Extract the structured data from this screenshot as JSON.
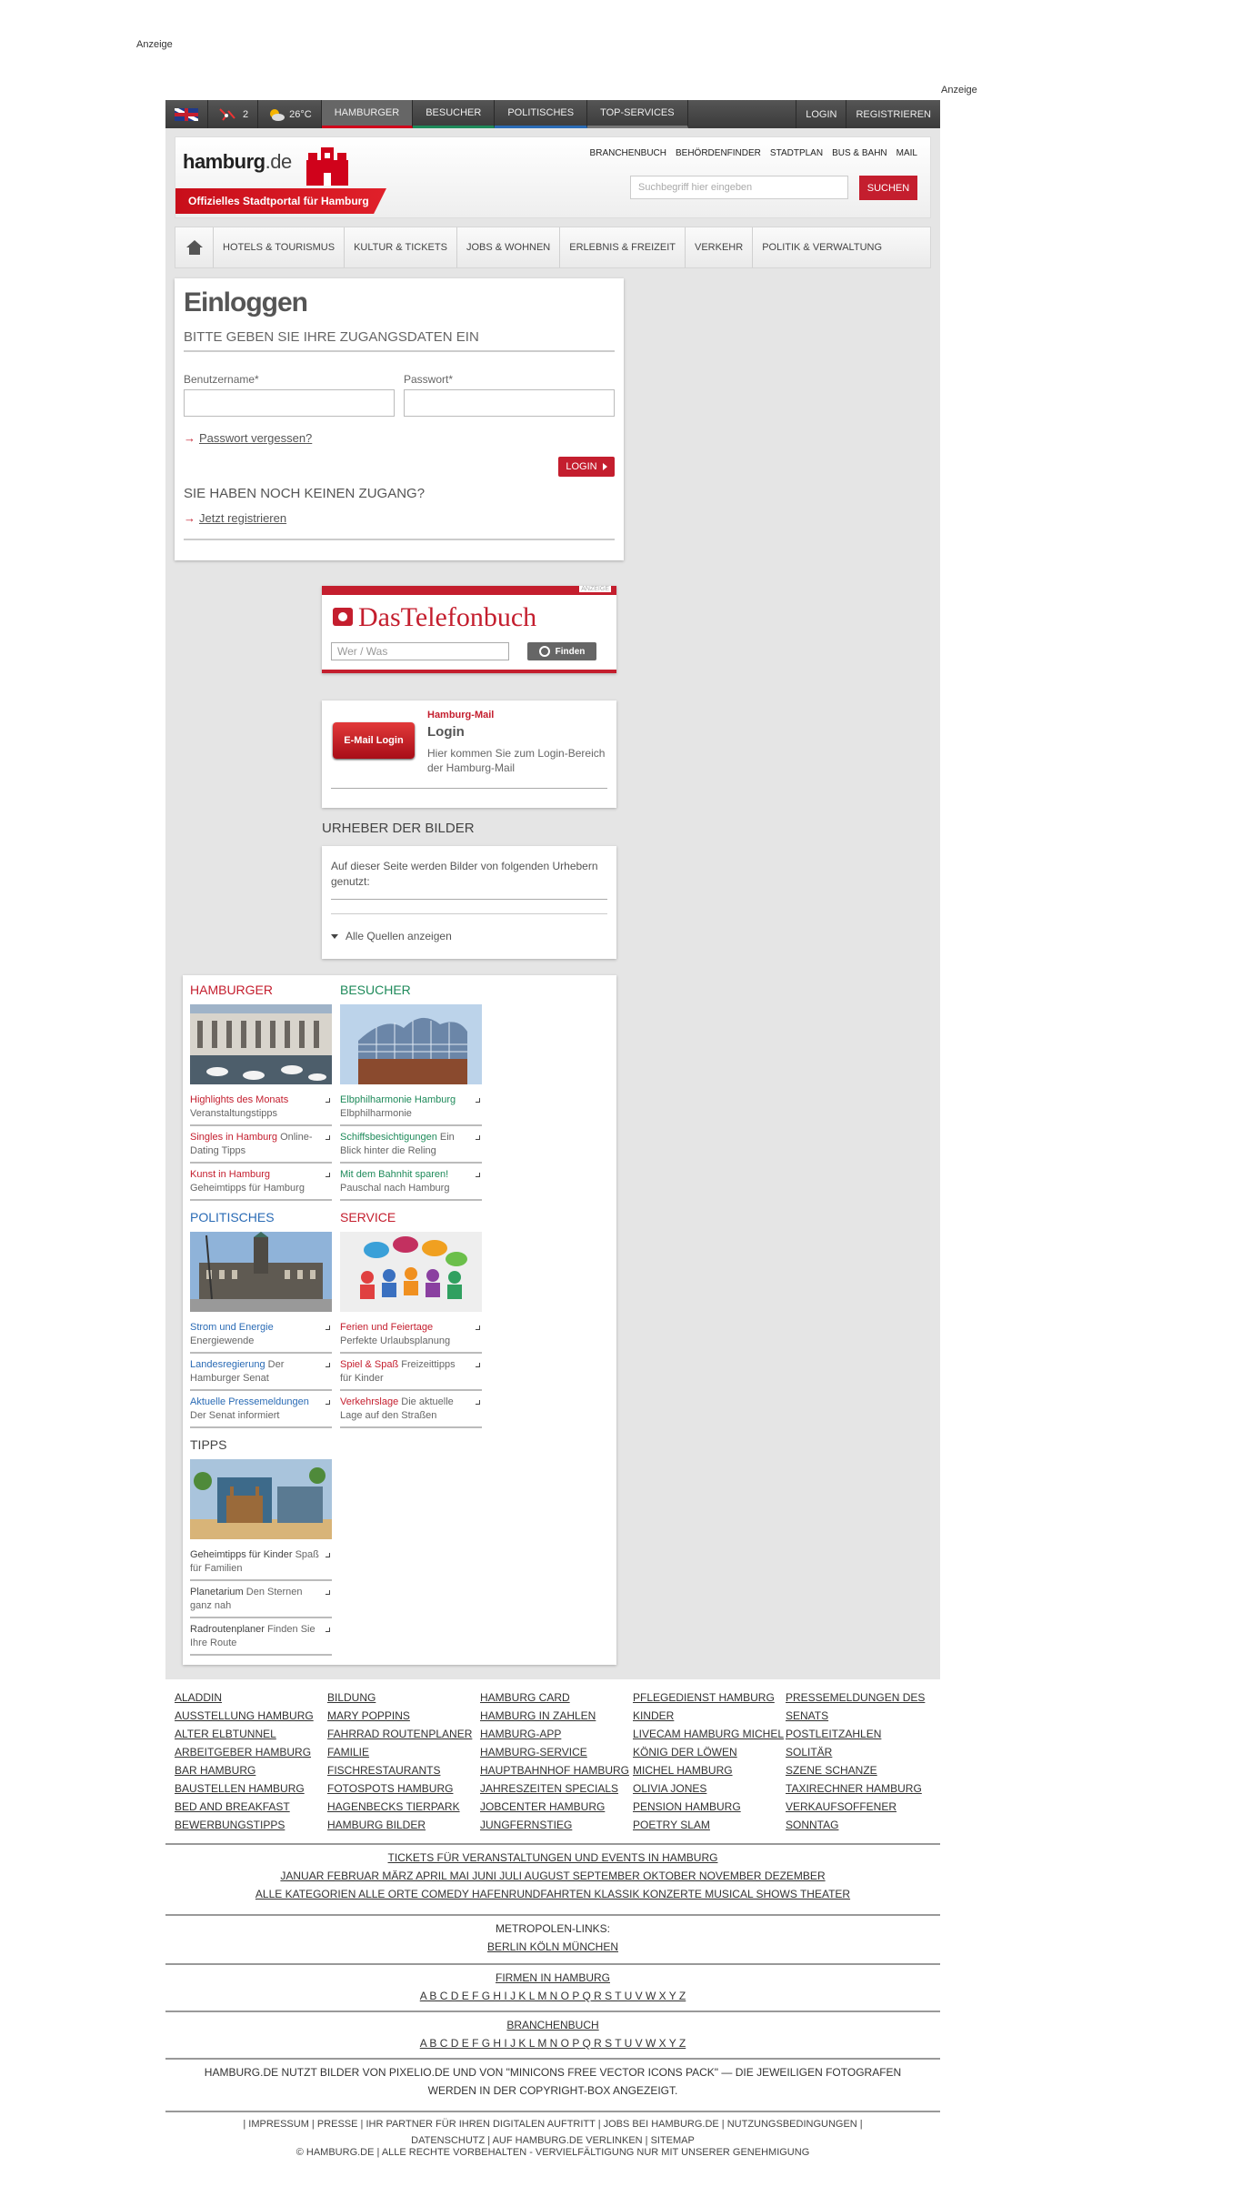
{
  "ads": {
    "top": "Anzeige",
    "right": "Anzeige"
  },
  "topbar": {
    "traffic_count": "2",
    "temperature": "26°C",
    "nav": [
      "HAMBURGER",
      "BESUCHER",
      "POLITISCHES",
      "TOP-SERVICES"
    ],
    "login": "LOGIN",
    "register": "REGISTRIEREN"
  },
  "header": {
    "logo": "hamburg",
    "logo_tld": ".de",
    "tagline": "Offizielles Stadtportal für Hamburg",
    "links": [
      "BRANCHENBUCH",
      "BEHÖRDENFINDER",
      "STADTPLAN",
      "BUS & BAHN",
      "MAIL"
    ],
    "search_placeholder": "Suchbegriff hier eingeben",
    "search_button": "SUCHEN"
  },
  "mainnav": [
    "HOTELS & TOURISMUS",
    "KULTUR & TICKETS",
    "JOBS & WOHNEN",
    "ERLEBNIS & FREIZEIT",
    "VERKEHR",
    "POLITIK & VERWALTUNG"
  ],
  "login": {
    "title": "Einloggen",
    "subtitle": "BITTE GEBEN SIE IHRE ZUGANGSDATEN EIN",
    "username_label": "Benutzername*",
    "password_label": "Passwort*",
    "forgot": "Passwort vergessen?",
    "button": "LOGIN",
    "no_access": "SIE HABEN NOCH KEINEN ZUGANG?",
    "register": "Jetzt registrieren"
  },
  "telefonbuch": {
    "ad_label": "ANZEIGE",
    "title": "DasTelefonbuch",
    "placeholder": "Wer / Was",
    "button": "Finden"
  },
  "mail": {
    "badge": "E-Mail Login",
    "kicker": "Hamburg-Mail",
    "title": "Login",
    "text": "Hier kommen Sie zum Login-Bereich der Hamburg-Mail"
  },
  "urheber": {
    "heading": "URHEBER DER BILDER",
    "text": "Auf dieser Seite werden Bilder von folgenden Urhebern genutzt:",
    "show_all": "Alle Quellen anzeigen"
  },
  "portal": {
    "hamburger": {
      "title": "HAMBURGER",
      "links": [
        {
          "a": "Highlights des Monats",
          "b": "Veranstaltungstipps"
        },
        {
          "a": "Singles in Hamburg",
          "b": "Online-Dating Tipps"
        },
        {
          "a": "Kunst in Hamburg",
          "b": "Geheimtipps für Hamburg"
        }
      ]
    },
    "besucher": {
      "title": "BESUCHER",
      "links": [
        {
          "a": "Elbphilharmonie Hamburg",
          "b": "Elbphilharmonie"
        },
        {
          "a": "Schiffsbesichtigungen",
          "b": "Ein Blick hinter die Reling"
        },
        {
          "a": "Mit dem Bahnhit sparen!",
          "b": "Pauschal nach Hamburg"
        }
      ]
    },
    "politisches": {
      "title": "POLITISCHES",
      "links": [
        {
          "a": "Strom und Energie",
          "b": "Energiewende"
        },
        {
          "a": "Landesregierung",
          "b": "Der Hamburger Senat"
        },
        {
          "a": "Aktuelle Pressemeldungen",
          "b": "Der Senat informiert"
        }
      ]
    },
    "service": {
      "title": "SERVICE",
      "links": [
        {
          "a": "Ferien und Feiertage",
          "b": "Perfekte Urlaubsplanung"
        },
        {
          "a": "Spiel & Spaß",
          "b": "Freizeittipps für Kinder"
        },
        {
          "a": "Verkehrslage",
          "b": "Die aktuelle Lage auf den Straßen"
        }
      ]
    },
    "tipps": {
      "title": "TIPPS",
      "links": [
        {
          "a": "Geheimtipps für Kinder",
          "b": "Spaß für Familien"
        },
        {
          "a": "Planetarium",
          "b": "Den Sternen ganz nah"
        },
        {
          "a": "Radroutenplaner",
          "b": "Finden Sie Ihre Route"
        }
      ]
    }
  },
  "footer": {
    "columns": [
      [
        "ALADDIN",
        "AUSSTELLUNG HAMBURG",
        "ALTER ELBTUNNEL",
        "ARBEITGEBER HAMBURG",
        "BAR HAMBURG",
        "BAUSTELLEN HAMBURG",
        "BED AND BREAKFAST",
        "BEWERBUNGSTIPPS"
      ],
      [
        "BILDUNG",
        "MARY POPPINS",
        "FAHRRAD ROUTENPLANER",
        "FAMILIE",
        "FISCHRESTAURANTS",
        "FOTOSPOTS HAMBURG",
        "HAGENBECKS TIERPARK",
        "HAMBURG BILDER"
      ],
      [
        "HAMBURG CARD",
        "HAMBURG IN ZAHLEN",
        "HAMBURG-APP",
        "HAMBURG-SERVICE",
        "HAUPTBAHNHOF HAMBURG",
        "JAHRESZEITEN SPECIALS",
        "JOBCENTER HAMBURG",
        "JUNGFERNSTIEG"
      ],
      [
        "PFLEGEDIENST HAMBURG",
        "KINDER",
        "LIVECAM HAMBURG MICHEL",
        "KÖNIG DER LÖWEN",
        "MICHEL HAMBURG",
        "OLIVIA JONES",
        "PENSION HAMBURG",
        "POETRY SLAM"
      ],
      [
        "PRESSEMELDUNGEN DES SENATS",
        "POSTLEITZAHLEN",
        "SOLITÄR",
        "SZENE SCHANZE",
        "TAXIRECHNER HAMBURG",
        "VERKAUFSOFFENER SONNTAG"
      ]
    ],
    "tickets_title": "TICKETS FÜR VERANSTALTUNGEN UND EVENTS IN HAMBURG",
    "months": "JANUAR FEBRUAR MÄRZ APRIL MAI JUNI JULI AUGUST SEPTEMBER OKTOBER NOVEMBER DEZEMBER",
    "categories": "ALLE KATEGORIEN ALLE ORTE COMEDY HAFENRUNDFAHRTEN KLASSIK KONZERTE MUSICAL SHOWS THEATER",
    "metro_title": "METROPOLEN-LINKS:",
    "metro_links": "BERLIN KÖLN MÜNCHEN",
    "firmen_title": "FIRMEN IN HAMBURG",
    "alphabet": "A B C D E F G H I J K L M N O P Q R S T U V W X Y Z",
    "branchen_title": "BRANCHENBUCH",
    "credits": "HAMBURG.DE NUTZT BILDER VON PIXELIO.DE UND VON \"MINICONS FREE VECTOR ICONS PACK\" — DIE JEWEILIGEN FOTOGRAFEN WERDEN IN DER COPYRIGHT-BOX ANGEZEIGT.",
    "links": "| IMPRESSUM | PRESSE | IHR PARTNER FÜR IHREN DIGITALEN AUFTRITT | JOBS BEI HAMBURG.DE | NUTZUNGSBEDINGUNGEN | DATENSCHUTZ | AUF HAMBURG.DE VERLINKEN | SITEMAP",
    "copyright": "© HAMBURG.DE | ALLE RECHTE VORBEHALTEN - VERVIELFÄLTIGUNG NUR MIT UNSERER GENEHMIGUNG"
  }
}
